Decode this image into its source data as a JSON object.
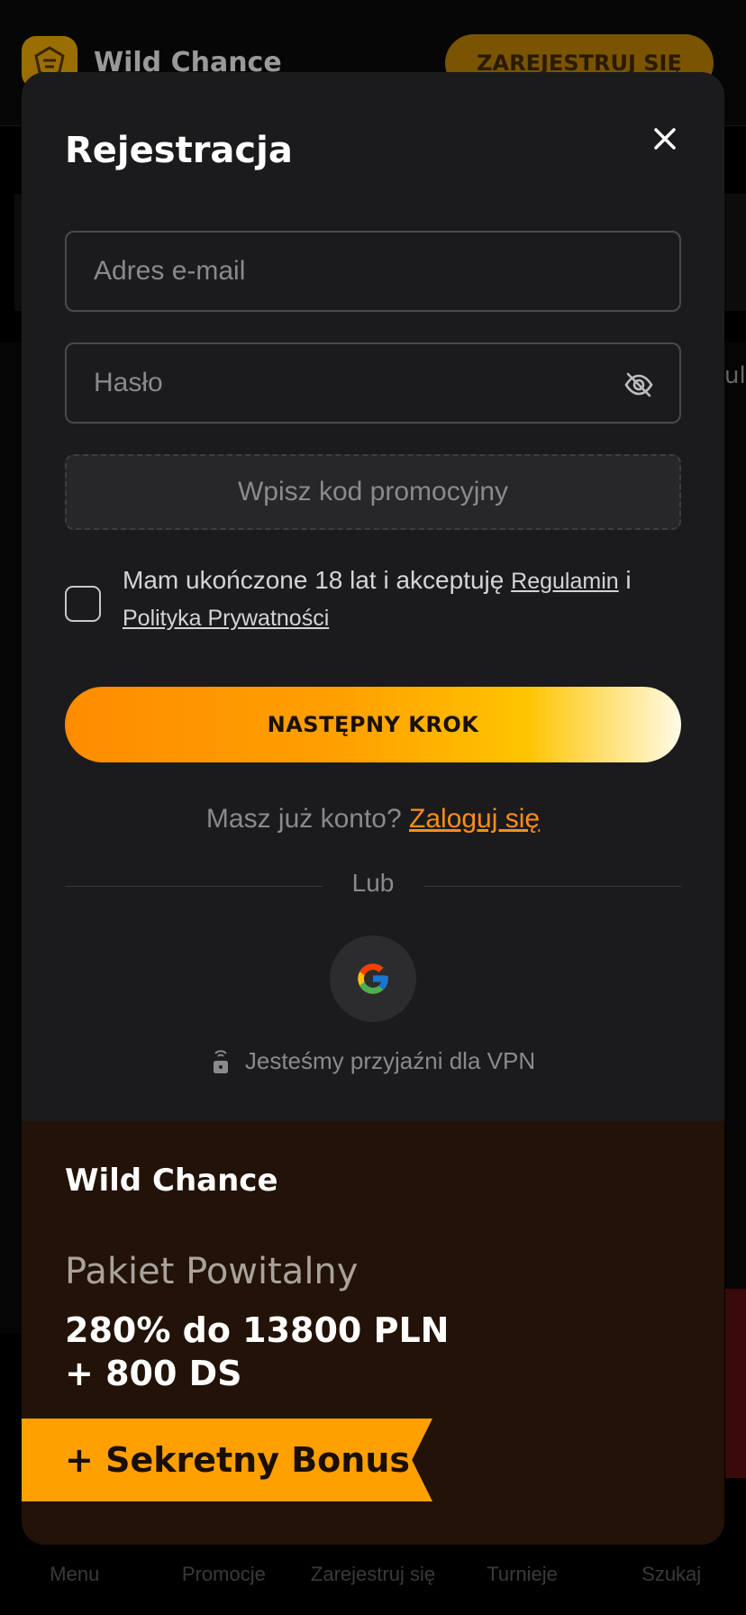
{
  "background": {
    "brand": "Wild Chance",
    "register_label": "ZAREJESTRUJ SIĘ",
    "peek_text": "ul"
  },
  "bottom_nav": [
    {
      "label": "Menu"
    },
    {
      "label": "Promocje"
    },
    {
      "label": "Zarejestruj się"
    },
    {
      "label": "Turnieje"
    },
    {
      "label": "Szukaj"
    }
  ],
  "modal": {
    "title": "Rejestracja",
    "email": {
      "placeholder": "Adres e-mail",
      "value": ""
    },
    "password": {
      "placeholder": "Hasło",
      "value": ""
    },
    "promo_label": "Wpisz kod promocyjny",
    "terms": {
      "prefix": "Mam ukończone 18 lat i akceptuję ",
      "regulamin": "Regulamin",
      "connector": " i",
      "privacy": "Polityka Prywatności",
      "checked": false
    },
    "next_button": "NASTĘPNY KROK",
    "login": {
      "question": "Masz już konto? ",
      "link": "Zaloguj się"
    },
    "divider": "Lub",
    "vpn": "Jesteśmy przyjaźni dla VPN"
  },
  "promo_section": {
    "brand": "Wild Chance",
    "kicker": "Pakiet Powitalny",
    "offer_line1": "280% do 13800 PLN",
    "offer_line2": "+ 800 DS",
    "secret": "+ Sekretny Bonus"
  },
  "colors": {
    "accent": "#ff8c1a",
    "button_start": "#ff8c00",
    "button_end": "#fffbe6",
    "modal_bg": "#1b1b1d",
    "promo_bg": "#221207",
    "ribbon": "#ffa000"
  },
  "icons": {
    "close": "close-icon",
    "eye": "eye-off-icon",
    "google": "google-icon",
    "vpn": "lock-signal-icon"
  }
}
